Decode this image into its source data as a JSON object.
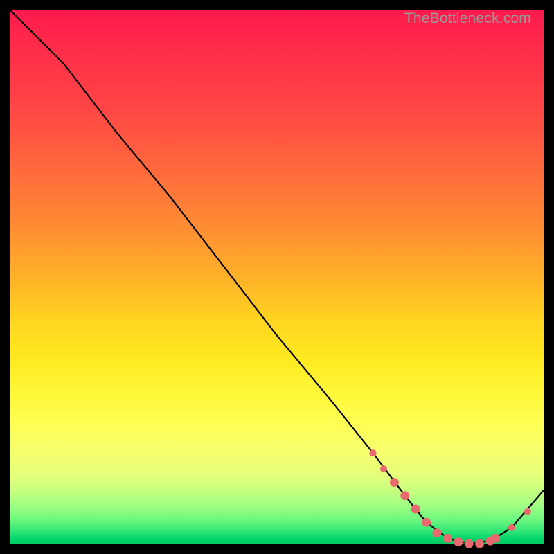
{
  "watermark": "TheBottleneck.com",
  "colors": {
    "curve_stroke": "#000000",
    "marker_fill": "#e86a6f",
    "marker_stroke": "#e86a6f"
  },
  "chart_data": {
    "type": "line",
    "title": "",
    "xlabel": "",
    "ylabel": "",
    "xlim": [
      0,
      100
    ],
    "ylim": [
      0,
      100
    ],
    "curve": {
      "x": [
        0,
        6,
        10,
        20,
        30,
        40,
        50,
        60,
        68,
        74,
        78,
        82,
        86,
        90,
        94,
        100
      ],
      "y": [
        100,
        94,
        90,
        77,
        65,
        52,
        39,
        27,
        17,
        9,
        4,
        1,
        0,
        0.5,
        3,
        10
      ]
    },
    "markers": {
      "x": [
        68,
        70,
        72,
        74,
        76,
        78,
        80,
        82,
        84,
        86,
        88,
        90,
        91,
        94,
        97
      ],
      "y": [
        17,
        14,
        11.5,
        9,
        6.5,
        4,
        2,
        1,
        0.3,
        0,
        0,
        0.5,
        1,
        3,
        6
      ]
    }
  }
}
